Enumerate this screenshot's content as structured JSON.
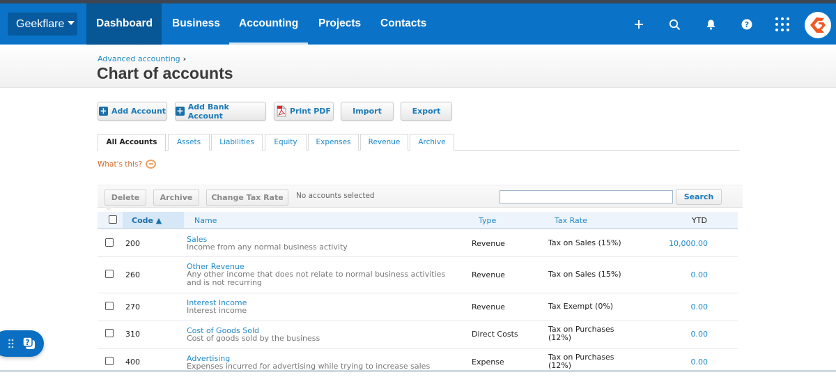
{
  "nav": {
    "org_name": "Geekflare",
    "items": [
      {
        "label": "Dashboard"
      },
      {
        "label": "Business"
      },
      {
        "label": "Accounting",
        "active": true
      },
      {
        "label": "Projects"
      },
      {
        "label": "Contacts"
      }
    ],
    "icons": [
      "plus-icon",
      "search-icon",
      "bell-icon",
      "help-icon",
      "apps-grid-icon",
      "avatar-logo"
    ]
  },
  "header": {
    "breadcrumb": "Advanced accounting",
    "breadcrumb_sep": "›",
    "title": "Chart of accounts"
  },
  "actions": {
    "add_account": "Add Account",
    "add_bank_account": "Add Bank Account",
    "print_pdf": "Print PDF",
    "import": "Import",
    "export": "Export"
  },
  "tabs": [
    {
      "label": "All Accounts",
      "active": true
    },
    {
      "label": "Assets"
    },
    {
      "label": "Liabilities"
    },
    {
      "label": "Equity"
    },
    {
      "label": "Expenses"
    },
    {
      "label": "Revenue"
    },
    {
      "label": "Archive"
    }
  ],
  "whats_this": "What's this?",
  "toolbar": {
    "delete": "Delete",
    "archive": "Archive",
    "change_tax_rate": "Change Tax Rate",
    "selection_status": "No accounts selected",
    "search_value": "",
    "search_button": "Search"
  },
  "table": {
    "columns": {
      "code": "Code ▲",
      "name": "Name",
      "type": "Type",
      "tax_rate": "Tax Rate",
      "ytd": "YTD"
    },
    "rows": [
      {
        "code": "200",
        "name": "Sales",
        "description": "Income from any normal business activity",
        "type": "Revenue",
        "tax_rate": "Tax on Sales (15%)",
        "ytd": "10,000.00"
      },
      {
        "code": "260",
        "name": "Other Revenue",
        "description": "Any other income that does not relate to normal business activities and is not recurring",
        "type": "Revenue",
        "tax_rate": "Tax on Sales (15%)",
        "ytd": "0.00"
      },
      {
        "code": "270",
        "name": "Interest Income",
        "description": "Interest income",
        "type": "Revenue",
        "tax_rate": "Tax Exempt (0%)",
        "ytd": "0.00"
      },
      {
        "code": "310",
        "name": "Cost of Goods Sold",
        "description": "Cost of goods sold by the business",
        "type": "Direct Costs",
        "tax_rate": "Tax on Purchases (12%)",
        "ytd": "0.00"
      },
      {
        "code": "400",
        "name": "Advertising",
        "description": "Expenses incurred for advertising while trying to increase sales",
        "type": "Expense",
        "tax_rate": "Tax on Purchases (12%)",
        "ytd": "0.00"
      }
    ]
  },
  "colors": {
    "nav_blue": "#0a73c8",
    "link_blue": "#1f8ac9",
    "brand_orange": "#f05a22"
  }
}
